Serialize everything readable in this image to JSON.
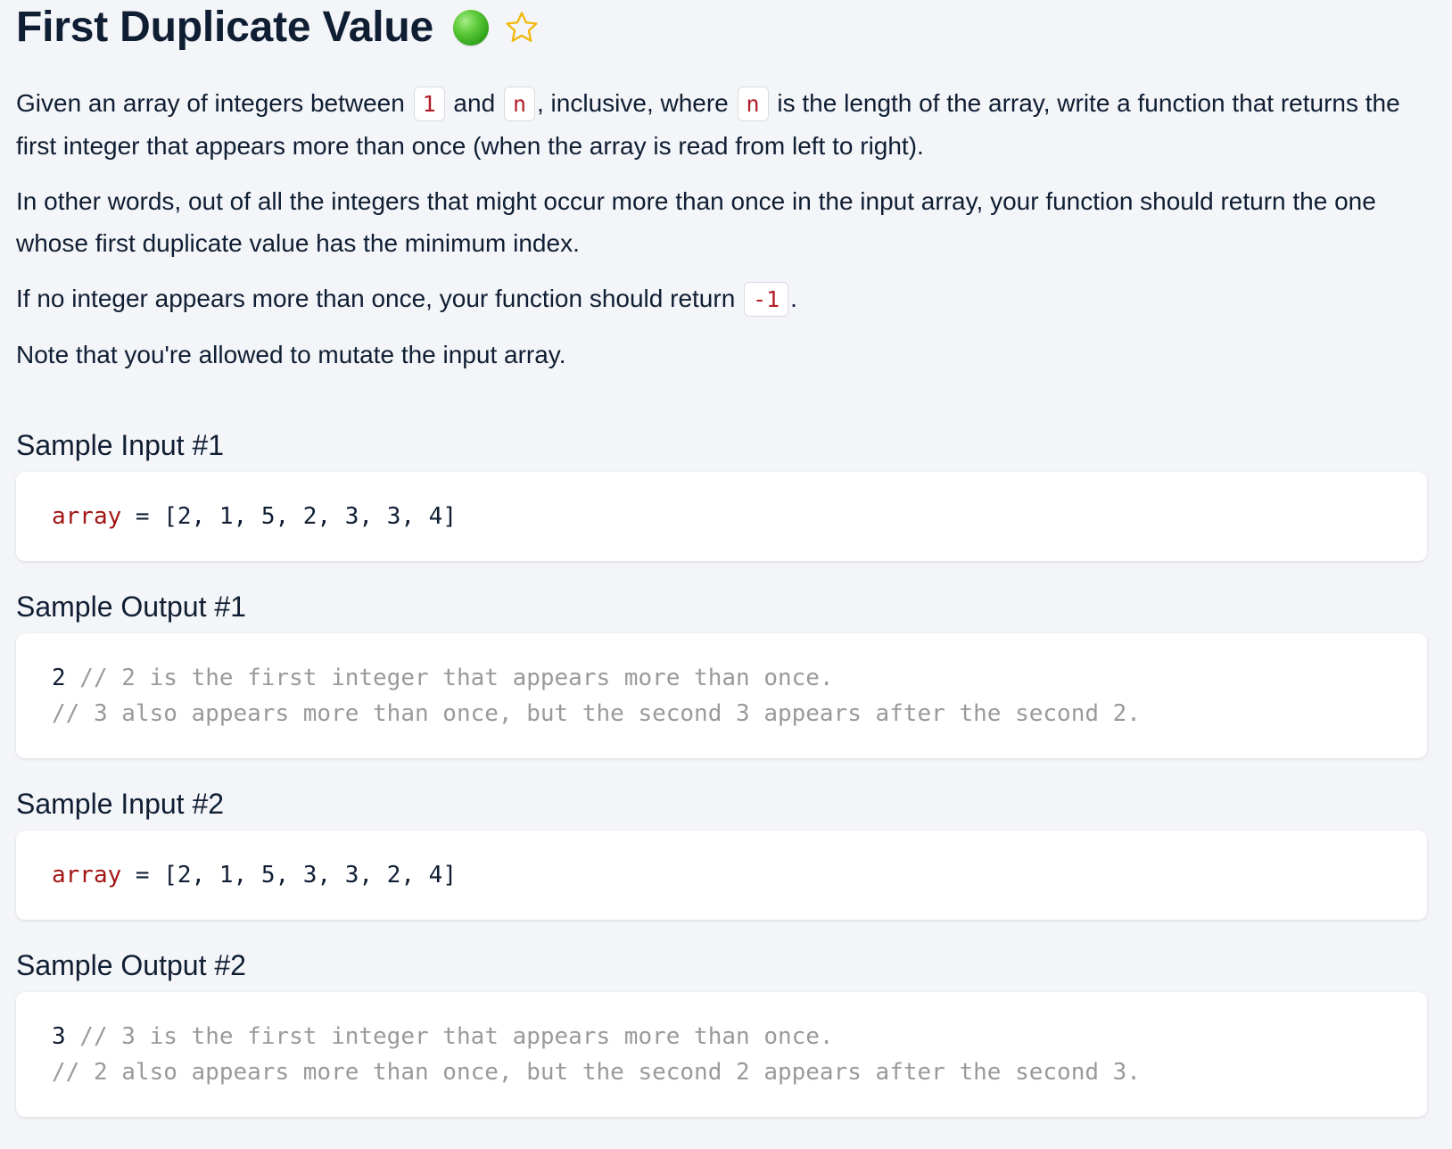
{
  "title": "First Duplicate Value",
  "difficulty_color": "#4cbb2f",
  "icons": {
    "difficulty": "green-dot-icon",
    "favorite": "star-outline-icon"
  },
  "star_color": "#f2b705",
  "paragraph1": {
    "t1": "Given an array of integers between ",
    "c1": "1",
    "t2": " and ",
    "c2": "n",
    "t3": ", inclusive, where ",
    "c3": "n",
    "t4": " is the length of the array, write a function that returns the first integer that appears more than once (when the array is read from left to right)."
  },
  "paragraph2": "In other words, out of all the integers that might occur more than once in the input array, your function should return the one whose first duplicate value has the minimum index.",
  "paragraph3": {
    "t1": "If no integer appears more than once, your function should return ",
    "c1": "-1",
    "t2": "."
  },
  "paragraph4": "Note that you're allowed to mutate the input array.",
  "sample_input_1": {
    "heading": "Sample Input #1",
    "var": "array",
    "op": " = ",
    "value": "[2, 1, 5, 2, 3, 3, 4]"
  },
  "sample_output_1": {
    "heading": "Sample Output #1",
    "value": "2",
    "comment1": " // 2 is the first integer that appears more than once.",
    "comment2": "// 3 also appears more than once, but the second 3 appears after the second 2."
  },
  "sample_input_2": {
    "heading": "Sample Input #2",
    "var": "array",
    "op": " = ",
    "value": "[2, 1, 5, 3, 3, 2, 4]"
  },
  "sample_output_2": {
    "heading": "Sample Output #2",
    "value": "3",
    "comment1": " // 3 is the first integer that appears more than once.",
    "comment2": "// 2 also appears more than once, but the second 2 appears after the second 3."
  }
}
